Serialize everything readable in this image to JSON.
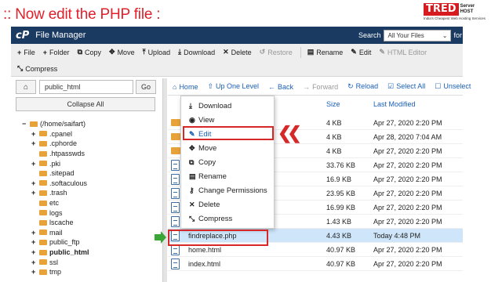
{
  "caption": ":: Now edit the PHP file :",
  "logo": {
    "brand": "TRED",
    "side_line1": "Server",
    "side_line2": "HOST",
    "tagline": "India's Cheapest Web Hosting Services",
    "color": "#d71920"
  },
  "header": {
    "logo_text": "cP",
    "title": "File Manager",
    "search_label": "Search",
    "search_select": "All Your Files",
    "search_suffix": "for",
    "bg_color": "#1a3a61"
  },
  "toolbar": {
    "row1": [
      {
        "icon": "plus-icon",
        "glyph": "+",
        "label": "File",
        "disabled": false
      },
      {
        "icon": "plus-icon",
        "glyph": "+",
        "label": "Folder",
        "disabled": false
      },
      {
        "icon": "copy-icon",
        "glyph": "⧉",
        "label": "Copy",
        "disabled": false
      },
      {
        "icon": "move-icon",
        "glyph": "✥",
        "label": "Move",
        "disabled": false
      },
      {
        "icon": "upload-icon",
        "glyph": "⤒",
        "label": "Upload",
        "disabled": false
      },
      {
        "icon": "download-icon",
        "glyph": "⤓",
        "label": "Download",
        "disabled": false
      },
      {
        "icon": "delete-icon",
        "glyph": "✕",
        "label": "Delete",
        "disabled": false
      },
      {
        "icon": "restore-icon",
        "glyph": "↺",
        "label": "Restore",
        "disabled": true
      },
      {
        "icon": "rename-icon",
        "glyph": "▤",
        "label": "Rename",
        "disabled": false
      },
      {
        "icon": "edit-icon",
        "glyph": "✎",
        "label": "Edit",
        "disabled": false
      },
      {
        "icon": "html-editor-icon",
        "glyph": "✎",
        "label": "HTML Editor",
        "disabled": true
      }
    ],
    "row2": [
      {
        "icon": "compress-icon",
        "glyph": "⤡",
        "label": "Compress",
        "disabled": false
      }
    ]
  },
  "left": {
    "path_value": "public_html",
    "go_label": "Go",
    "collapse_label": "Collapse All",
    "tree": [
      {
        "exp": "−",
        "label": "(/home/saifart)",
        "home": true,
        "bold": false,
        "indent": 0
      },
      {
        "exp": "+",
        "label": ".cpanel",
        "bold": false,
        "indent": 1
      },
      {
        "exp": "+",
        "label": ".cphorde",
        "bold": false,
        "indent": 1
      },
      {
        "exp": "",
        "label": ".htpasswds",
        "bold": false,
        "indent": 1
      },
      {
        "exp": "+",
        "label": ".pki",
        "bold": false,
        "indent": 1
      },
      {
        "exp": "",
        "label": ".sitepad",
        "bold": false,
        "indent": 1
      },
      {
        "exp": "+",
        "label": ".softaculous",
        "bold": false,
        "indent": 1
      },
      {
        "exp": "+",
        "label": ".trash",
        "bold": false,
        "indent": 1
      },
      {
        "exp": "",
        "label": "etc",
        "bold": false,
        "indent": 1
      },
      {
        "exp": "",
        "label": "logs",
        "bold": false,
        "indent": 1
      },
      {
        "exp": "",
        "label": "lscache",
        "bold": false,
        "indent": 1
      },
      {
        "exp": "+",
        "label": "mail",
        "bold": false,
        "indent": 1
      },
      {
        "exp": "+",
        "label": "public_ftp",
        "bold": false,
        "indent": 1
      },
      {
        "exp": "+",
        "label": "public_html",
        "bold": true,
        "indent": 1
      },
      {
        "exp": "+",
        "label": "ssl",
        "bold": false,
        "indent": 1
      },
      {
        "exp": "+",
        "label": "tmp",
        "bold": false,
        "indent": 1
      }
    ]
  },
  "nav": [
    {
      "icon": "home-icon",
      "glyph": "⌂",
      "label": "Home",
      "disabled": false
    },
    {
      "icon": "up-icon",
      "glyph": "⇧",
      "label": "Up One Level",
      "disabled": false
    },
    {
      "icon": "back-icon",
      "glyph": "←",
      "label": "Back",
      "disabled": false
    },
    {
      "icon": "forward-icon",
      "glyph": "→",
      "label": "Forward",
      "disabled": true
    },
    {
      "icon": "reload-icon",
      "glyph": "↻",
      "label": "Reload",
      "disabled": false
    },
    {
      "icon": "select-all-icon",
      "glyph": "☑",
      "label": "Select All",
      "disabled": false
    },
    {
      "icon": "unselect-icon",
      "glyph": "☐",
      "label": "Unselect",
      "disabled": false
    }
  ],
  "columns": {
    "size": "Size",
    "modified": "Last Modified"
  },
  "files": [
    {
      "type": "folder",
      "name": "",
      "size": "4 KB",
      "modified": "Apr 27, 2020 2:20 PM",
      "selected": false
    },
    {
      "type": "folder",
      "name": "",
      "size": "4 KB",
      "modified": "Apr 28, 2020 7:04 AM",
      "selected": false
    },
    {
      "type": "folder",
      "name": "",
      "size": "4 KB",
      "modified": "Apr 27, 2020 2:20 PM",
      "selected": false
    },
    {
      "type": "file",
      "name": "",
      "size": "33.76 KB",
      "modified": "Apr 27, 2020 2:20 PM",
      "selected": false
    },
    {
      "type": "file",
      "name": "",
      "size": "16.9 KB",
      "modified": "Apr 27, 2020 2:20 PM",
      "selected": false
    },
    {
      "type": "file",
      "name": "",
      "size": "23.95 KB",
      "modified": "Apr 27, 2020 2:20 PM",
      "selected": false
    },
    {
      "type": "file",
      "name": "",
      "size": "16.99 KB",
      "modified": "Apr 27, 2020 2:20 PM",
      "selected": false
    },
    {
      "type": "file",
      "name": "",
      "size": "1.43 KB",
      "modified": "Apr 27, 2020 2:20 PM",
      "selected": false
    },
    {
      "type": "file",
      "name": "findreplace.php",
      "size": "4.43 KB",
      "modified": "Today 4:48 PM",
      "selected": true
    },
    {
      "type": "file",
      "name": "home.html",
      "size": "40.97 KB",
      "modified": "Apr 27, 2020 2:20 PM",
      "selected": false
    },
    {
      "type": "file",
      "name": "index.html",
      "size": "40.97 KB",
      "modified": "Apr 27, 2020 2:20 PM",
      "selected": false
    }
  ],
  "context_menu": [
    {
      "icon": "download-icon",
      "glyph": "⤓",
      "label": "Download"
    },
    {
      "icon": "eye-icon",
      "glyph": "◉",
      "label": "View"
    },
    {
      "icon": "pencil-icon",
      "glyph": "✎",
      "label": "Edit"
    },
    {
      "icon": "move-icon",
      "glyph": "✥",
      "label": "Move"
    },
    {
      "icon": "copy-icon",
      "glyph": "⧉",
      "label": "Copy"
    },
    {
      "icon": "rename-icon",
      "glyph": "▤",
      "label": "Rename"
    },
    {
      "icon": "key-icon",
      "glyph": "⚷",
      "label": "Change Permissions"
    },
    {
      "icon": "delete-icon",
      "glyph": "✕",
      "label": "Delete"
    },
    {
      "icon": "compress-icon",
      "glyph": "⤡",
      "label": "Compress"
    }
  ],
  "annotations": {
    "red_arrows": "❮❮",
    "highlight_color": "#d62828",
    "green_arrow_color": "#3aa635"
  }
}
